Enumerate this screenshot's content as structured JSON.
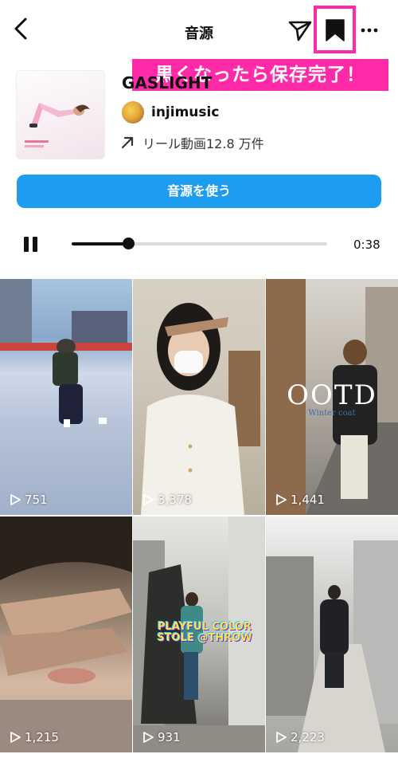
{
  "header": {
    "title": "音源",
    "annotation": "黒くなったら保存完了！"
  },
  "audio": {
    "title": "GASLIGHT",
    "artist": "injimusic",
    "reels_label": "リール動画12.8 万件"
  },
  "actions": {
    "use_audio": "音源を使う"
  },
  "player": {
    "progress": 0.22,
    "time": "0:38"
  },
  "colors": {
    "accent_blue": "#1e9cf0",
    "highlight_pink": "#ff2aa8"
  },
  "icons": [
    "chevron-left-icon",
    "send-icon",
    "bookmark-icon",
    "more-icon",
    "arrow-up-right-icon",
    "pause-icon",
    "play-icon"
  ],
  "reels": [
    {
      "views": "751"
    },
    {
      "views": "3,378"
    },
    {
      "views": "1,441",
      "caption": "OOTD",
      "subcaption": "Winter coat"
    },
    {
      "views": "1,215"
    },
    {
      "views": "931",
      "caption": "PLAYFUL COLOR STOLE @THROW"
    },
    {
      "views": "2,223"
    }
  ]
}
